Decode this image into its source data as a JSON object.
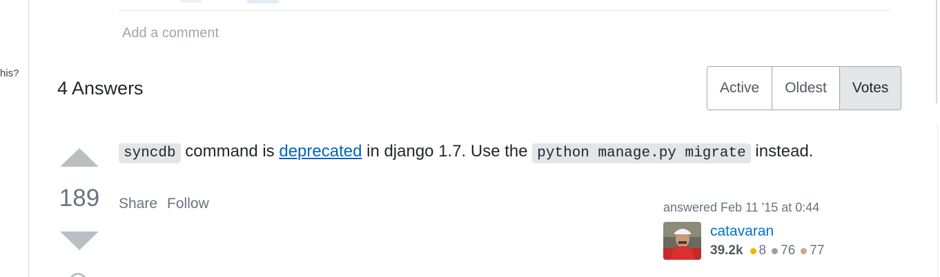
{
  "sidebar": {
    "fragment_text": "his?"
  },
  "comments": {
    "add_comment_label": "Add a comment"
  },
  "answers": {
    "heading": "4 Answers",
    "sort_options": [
      {
        "label": "Active",
        "selected": false
      },
      {
        "label": "Oldest",
        "selected": false
      },
      {
        "label": "Votes",
        "selected": true
      }
    ]
  },
  "answer": {
    "vote_count": "189",
    "body": {
      "code_1": "syncdb",
      "text_1": " command is ",
      "link_text": "deprecated",
      "text_2": " in django 1.7. Use the ",
      "code_2": "python manage.py migrate",
      "text_3": " instead."
    },
    "menu": {
      "share_label": "Share",
      "follow_label": "Follow"
    },
    "meta": {
      "answered_text": "answered Feb 11 '15 at 0:44",
      "user_name": "catavaran",
      "reputation": "39.2k",
      "badges": {
        "gold": "8",
        "silver": "76",
        "bronze": "77"
      }
    }
  },
  "colors": {
    "link": "#0063bf",
    "user_link": "#0074cc",
    "gold_badge": "#f1b600",
    "silver_badge": "#9a9fa4",
    "bronze_badge": "#d1a684",
    "vote_arrow": "#babfc4",
    "selected_sort_bg": "#e3e6e8"
  },
  "icons": {
    "vote_up": "triangle-up-icon",
    "vote_down": "triangle-down-icon",
    "bookmark": "bookmark-icon"
  }
}
